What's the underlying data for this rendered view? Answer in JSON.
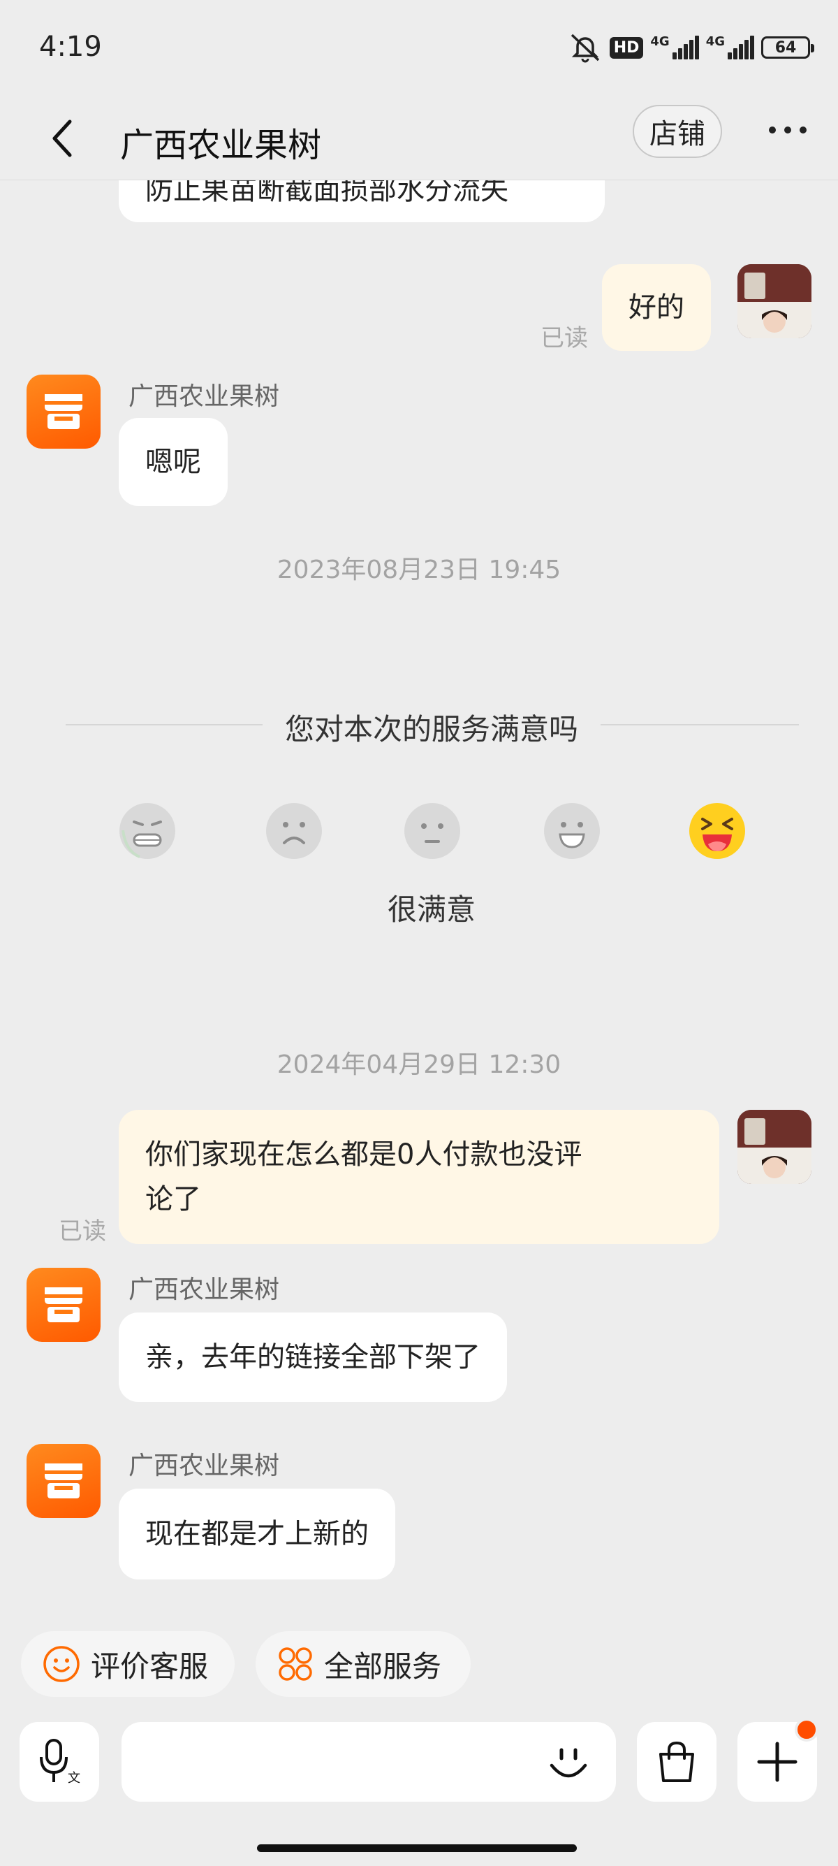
{
  "status_bar": {
    "time": "4:19",
    "hd_label": "HD",
    "network_1": "4G",
    "network_2": "4G",
    "battery": "64"
  },
  "header": {
    "title": "广西农业果树",
    "shop_button": "店铺"
  },
  "messages": {
    "partial_top": "防止果苗断截面损部水分流失",
    "m1_text": "好的",
    "m1_status": "已读",
    "m2_sender": "广西农业果树",
    "m2_text": "嗯呢",
    "ts1": "2023年08月23日 19:45",
    "ts2": "2024年04月29日 12:30",
    "m3_line1": "你们家现在怎么都是0人付款也没评",
    "m3_line2": "论了",
    "m3_status": "已读",
    "m4_sender": "广西农业果树",
    "m4_text": "亲，去年的链接全部下架了",
    "m5_sender": "广西农业果树",
    "m5_text": "现在都是才上新的"
  },
  "survey": {
    "title": "您对本次的服务满意吗",
    "faces": [
      "very-dissatisfied-face-icon",
      "dissatisfied-face-icon",
      "neutral-face-icon",
      "satisfied-face-icon",
      "very-satisfied-face-icon"
    ],
    "selected_label": "很满意"
  },
  "chips": {
    "rate": "评价客服",
    "all_services": "全部服务"
  },
  "colors": {
    "brand_orange": "#ff6a00",
    "user_bubble": "#fff7e6",
    "background": "#ededed"
  }
}
